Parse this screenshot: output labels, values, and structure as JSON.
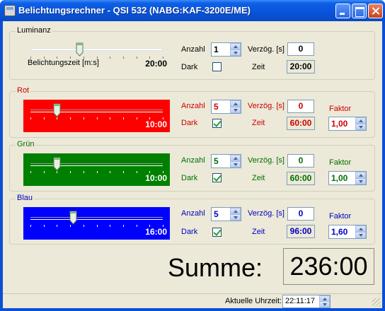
{
  "window": {
    "title": "Belichtungsrechner - QSI 532 (NABG:KAF-3200E/ME)"
  },
  "labels": {
    "anzahl": "Anzahl",
    "verzoeg": "Verzög. [s]",
    "zeit": "Zeit",
    "dark": "Dark",
    "faktor": "Faktor",
    "belichtungszeit": "Belichtungszeit [m:s]"
  },
  "luminanz": {
    "label": "Luminanz",
    "slider_time": "20:00",
    "slider_level": 0.37,
    "anzahl": "1",
    "verzoeg": "0",
    "dark": false,
    "zeit": "20:00",
    "color": "#ece9d8"
  },
  "rot": {
    "label": "Rot",
    "slider_time": "10:00",
    "slider_level": 0.2,
    "anzahl": "5",
    "verzoeg": "0",
    "dark": true,
    "zeit": "60:00",
    "faktor": "1,00",
    "color": "#ff0000",
    "text_color": "#cc0000"
  },
  "gruen": {
    "label": "Grün",
    "slider_time": "10:00",
    "slider_level": 0.2,
    "anzahl": "5",
    "verzoeg": "0",
    "dark": true,
    "zeit": "60:00",
    "faktor": "1,00",
    "color": "#008000",
    "text_color": "#007000"
  },
  "blau": {
    "label": "Blau",
    "slider_time": "16:00",
    "slider_level": 0.32,
    "anzahl": "5",
    "verzoeg": "0",
    "dark": true,
    "zeit": "96:00",
    "faktor": "1,60",
    "color": "#0000ff",
    "text_color": "#0000c0"
  },
  "summe": {
    "label": "Summe:",
    "value": "236:00"
  },
  "status": {
    "label": "Aktuelle Uhrzeit:",
    "time": "22:11:17"
  }
}
